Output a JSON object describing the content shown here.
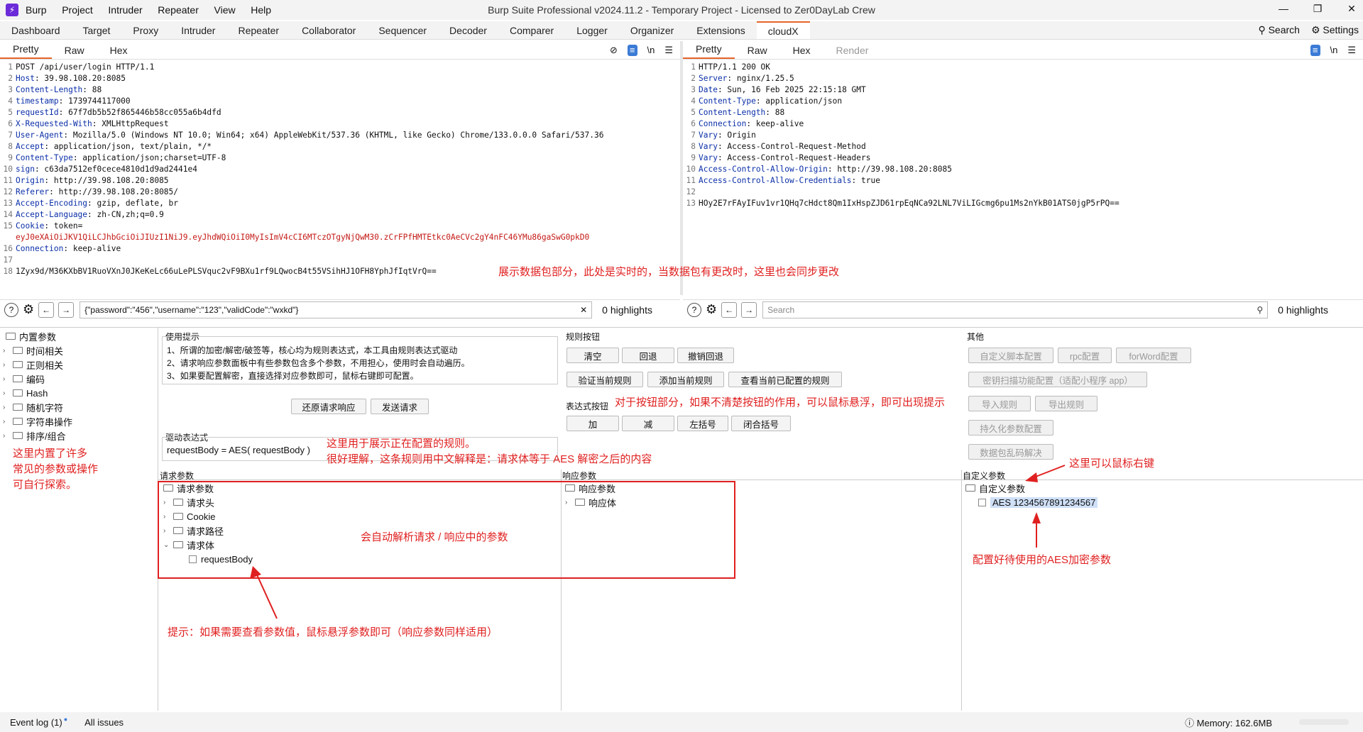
{
  "app": {
    "menu": [
      "Burp",
      "Project",
      "Intruder",
      "Repeater",
      "View",
      "Help"
    ],
    "title": "Burp Suite Professional v2024.11.2 - Temporary Project - Licensed to Zer0DayLab Crew"
  },
  "tabs": [
    "Dashboard",
    "Target",
    "Proxy",
    "Intruder",
    "Repeater",
    "Collaborator",
    "Sequencer",
    "Decoder",
    "Comparer",
    "Logger",
    "Organizer",
    "Extensions",
    "cloudX"
  ],
  "tab_right": {
    "search": "Search",
    "settings": "Settings"
  },
  "request": {
    "subtabs": [
      "Pretty",
      "Raw",
      "Hex"
    ],
    "lines": [
      {
        "n": "1",
        "k": "",
        "v": "POST /api/user/login HTTP/1.1"
      },
      {
        "n": "2",
        "k": "Host",
        "v": ": 39.98.108.20:8085"
      },
      {
        "n": "3",
        "k": "Content-Length",
        "v": ": 88"
      },
      {
        "n": "4",
        "k": "timestamp",
        "v": ": 1739744117000"
      },
      {
        "n": "5",
        "k": "requestId",
        "v": ": 67f7db5b52f865446b58cc055a6b4dfd"
      },
      {
        "n": "6",
        "k": "X-Requested-With",
        "v": ": XMLHttpRequest"
      },
      {
        "n": "7",
        "k": "User-Agent",
        "v": ": Mozilla/5.0 (Windows NT 10.0; Win64; x64) AppleWebKit/537.36 (KHTML, like Gecko) Chrome/133.0.0.0 Safari/537.36"
      },
      {
        "n": "8",
        "k": "Accept",
        "v": ": application/json, text/plain, */*"
      },
      {
        "n": "9",
        "k": "Content-Type",
        "v": ": application/json;charset=UTF-8"
      },
      {
        "n": "10",
        "k": "sign",
        "v": ": c63da7512ef0cece4810d1d9ad2441e4"
      },
      {
        "n": "11",
        "k": "Origin",
        "v": ": http://39.98.108.20:8085"
      },
      {
        "n": "12",
        "k": "Referer",
        "v": ": http://39.98.108.20:8085/"
      },
      {
        "n": "13",
        "k": "Accept-Encoding",
        "v": ": gzip, deflate, br"
      },
      {
        "n": "14",
        "k": "Accept-Language",
        "v": ": zh-CN,zh;q=0.9"
      },
      {
        "n": "15",
        "k": "Cookie",
        "v": ": token="
      },
      {
        "n": "",
        "k": "",
        "v": "eyJ0eXAiOiJKV1QiLCJhbGciOiJIUzI1NiJ9.eyJhdWQiOiI0MyIsImV4cCI6MTczOTgyNjQwM30.zCrFPfHMTEtkc0AeCVc2gY4nFC46YMu86gaSwG0pkD0",
        "tok": true
      },
      {
        "n": "16",
        "k": "Connection",
        "v": ": keep-alive"
      },
      {
        "n": "17",
        "k": "",
        "v": ""
      },
      {
        "n": "18",
        "k": "",
        "v": "1Zyx9d/M36KXbBV1RuoVXnJ0JKeKeLc66uLePLSVquc2vF9BXu1rf9LQwocB4t55VSihHJ1OFH8YphJfIqtVrQ=="
      }
    ]
  },
  "response": {
    "subtabs": [
      "Pretty",
      "Raw",
      "Hex",
      "Render"
    ],
    "lines": [
      {
        "n": "1",
        "k": "",
        "v": "HTTP/1.1 200 OK"
      },
      {
        "n": "2",
        "k": "Server",
        "v": ": nginx/1.25.5"
      },
      {
        "n": "3",
        "k": "Date",
        "v": ": Sun, 16 Feb 2025 22:15:18 GMT"
      },
      {
        "n": "4",
        "k": "Content-Type",
        "v": ": application/json"
      },
      {
        "n": "5",
        "k": "Content-Length",
        "v": ": 88"
      },
      {
        "n": "6",
        "k": "Connection",
        "v": ": keep-alive"
      },
      {
        "n": "7",
        "k": "Vary",
        "v": ": Origin"
      },
      {
        "n": "8",
        "k": "Vary",
        "v": ": Access-Control-Request-Method"
      },
      {
        "n": "9",
        "k": "Vary",
        "v": ": Access-Control-Request-Headers"
      },
      {
        "n": "10",
        "k": "Access-Control-Allow-Origin",
        "v": ": http://39.98.108.20:8085"
      },
      {
        "n": "11",
        "k": "Access-Control-Allow-Credentials",
        "v": ": true"
      },
      {
        "n": "12",
        "k": "",
        "v": ""
      },
      {
        "n": "13",
        "k": "",
        "v": "HOy2E7rFAyIFuv1vr1QHq7cHdct8Qm1IxHspZJD61rpEqNCa92LNL7ViLIGcmg6pu1Ms2nYkB01ATS0jgP5rPQ=="
      }
    ]
  },
  "req_search": {
    "value": "{\"password\":\"456\",\"username\":\"123\",\"validCode\":\"wxkd\"}",
    "highlights": "0 highlights"
  },
  "resp_search": {
    "placeholder": "Search",
    "highlights": "0 highlights"
  },
  "builtin": {
    "title": "内置参数",
    "items": [
      "时间相关",
      "正则相关",
      "编码",
      "Hash",
      "随机字符",
      "字符串操作",
      "排序/组合"
    ]
  },
  "usage": {
    "title": "使用提示",
    "lines": [
      "1、所谓的加密/解密/破签等，核心均为规则表达式，本工具由规则表达式驱动",
      "2、请求响应参数面板中有些参数包含多个参数，不用担心，使用时会自动遍历。",
      "3、如果要配置解密，直接选择对应参数即可，鼠标右键即可配置。"
    ],
    "restore": "还原请求响应",
    "send": "发送请求"
  },
  "driver": {
    "title": "驱动表达式",
    "expr": "requestBody = AES( requestBody )"
  },
  "rules": {
    "title": "规则按钮",
    "row1": [
      "清空",
      "回退",
      "撤销回退"
    ],
    "row2": [
      "验证当前规则",
      "添加当前规则",
      "查看当前已配置的规则"
    ]
  },
  "exprbtns": {
    "title": "表达式按钮",
    "items": [
      "加",
      "减",
      "左括号",
      "闭合括号"
    ]
  },
  "other": {
    "title": "其他",
    "items": [
      "自定义脚本配置",
      "rpc配置",
      "forWord配置",
      "密钥扫描功能配置（适配小程序 app）",
      "导入规则",
      "导出规则",
      "持久化参数配置",
      "数据包乱码解决"
    ]
  },
  "reqparams": {
    "title": "请求参数",
    "root": "请求参数",
    "items": [
      "请求头",
      "Cookie",
      "请求路径",
      "请求体"
    ],
    "leaf": "requestBody"
  },
  "respparams": {
    "title": "响应参数",
    "root": "响应参数",
    "items": [
      "响应体"
    ]
  },
  "customparams": {
    "title": "自定义参数",
    "root": "自定义参数",
    "leaf": "AES 1234567891234567"
  },
  "annotations": {
    "a1": "展示数据包部分，此处是实时的，当数据包有更改时，这里也会同步更改",
    "a2": "对于按钮部分，如果不清楚按钮的作用，可以鼠标悬浮，即可出现提示",
    "a3": "这里用于展示正在配置的规则。",
    "a4": "很好理解，这条规则用中文解释是：请求体等于 AES 解密之后的内容",
    "a5": "这里内置了许多",
    "a6": "常见的参数或操作",
    "a7": "可自行探索。",
    "a8": "这里可以鼠标右键",
    "a9": "会自动解析请求 / 响应中的参数",
    "a10": "配置好待使用的AES加密参数",
    "a11": "提示：如果需要查看参数值，鼠标悬浮参数即可（响应参数同样适用）"
  },
  "status": {
    "eventlog": "Event log (1)",
    "issues": "All issues",
    "memory": "Memory: 162.6MB"
  },
  "colors": {
    "accent": "#e8642a",
    "annotation": "#e02020",
    "selection": "#cfe0f7"
  }
}
